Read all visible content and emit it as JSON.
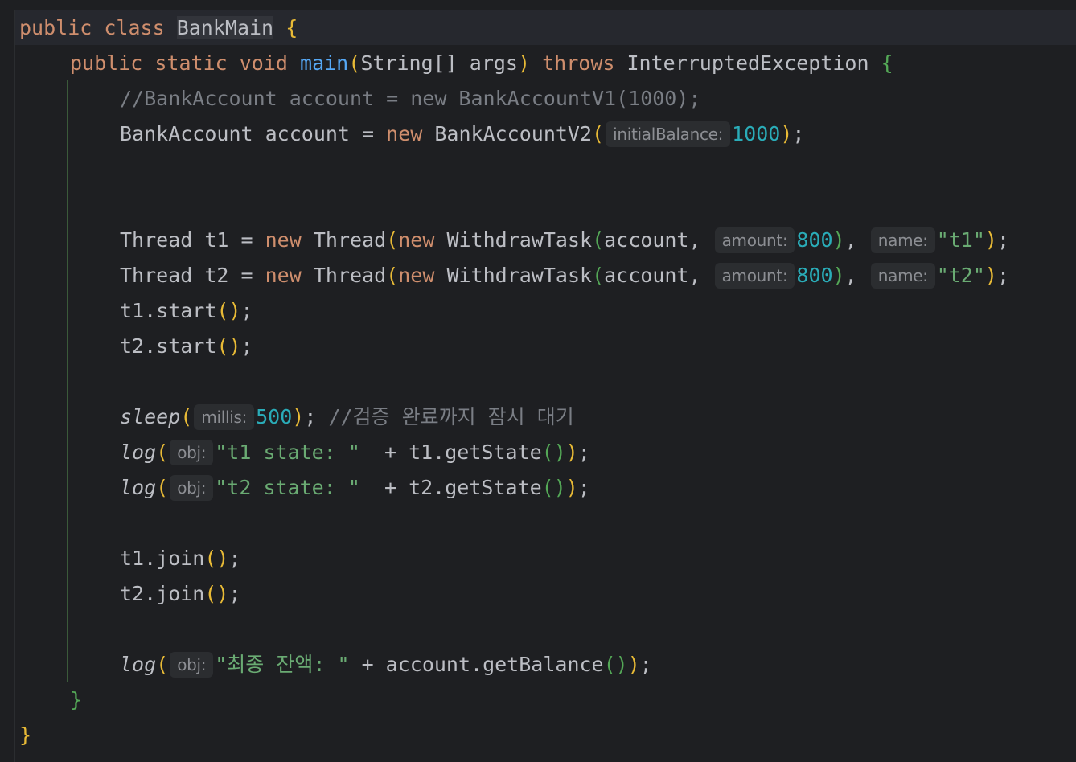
{
  "editor": {
    "class_decl": {
      "kw_public": "public",
      "kw_class": "class",
      "class_name": "BankMain",
      "open_brace": "{"
    },
    "main_decl": {
      "kw_public": "public",
      "kw_static": "static",
      "kw_void": "void",
      "method": "main",
      "params": "String[] args",
      "kw_throws": "throws",
      "exception": "InterruptedException",
      "open_brace": "{"
    },
    "comment_v1": "//BankAccount account = new BankAccountV1(1000);",
    "account_line": {
      "type": "BankAccount account = ",
      "kw_new": "new",
      "ctor": "BankAccountV2",
      "hint": "initialBalance:",
      "value": "1000"
    },
    "thread_lines": [
      {
        "prefix": "Thread t1 = ",
        "kw_new1": "new",
        "thread": "Thread",
        "kw_new2": "new",
        "task": "WithdrawTask",
        "arg": "account, ",
        "hint_amount": "amount:",
        "amount": "800",
        "hint_name": "name:",
        "name": "\"t1\""
      },
      {
        "prefix": "Thread t2 = ",
        "kw_new1": "new",
        "thread": "Thread",
        "kw_new2": "new",
        "task": "WithdrawTask",
        "arg": "account, ",
        "hint_amount": "amount:",
        "amount": "800",
        "hint_name": "name:",
        "name": "\"t2\""
      }
    ],
    "start_lines": [
      "t1.start",
      "t2.start"
    ],
    "sleep_line": {
      "fn": "sleep",
      "hint": "millis:",
      "value": "500",
      "comment": "//검증 완료까지 잠시 대기"
    },
    "log_lines": [
      {
        "fn": "log",
        "hint": "obj:",
        "str": "\"t1 state: \"",
        "rest": "  + t1.getState"
      },
      {
        "fn": "log",
        "hint": "obj:",
        "str": "\"t2 state: \"",
        "rest": "  + t2.getState"
      }
    ],
    "join_lines": [
      "t1.join",
      "t2.join"
    ],
    "final_log": {
      "fn": "log",
      "hint": "obj:",
      "str": "\"최종 잔액: \"",
      "rest": " + account.getBalance"
    },
    "close_main": "}",
    "close_class": "}"
  }
}
